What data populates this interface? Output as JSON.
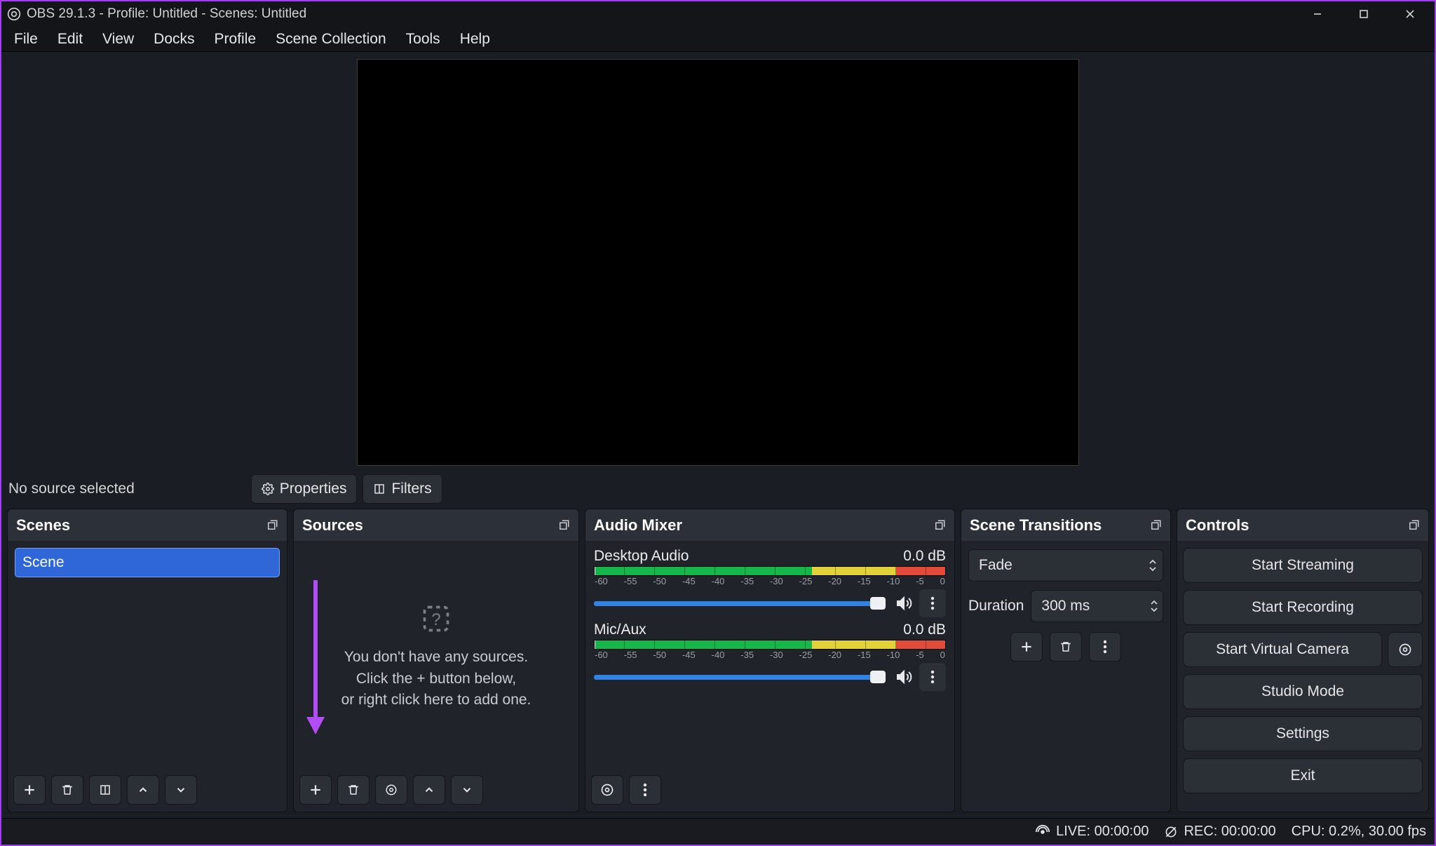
{
  "titlebar": {
    "title": "OBS 29.1.3 - Profile: Untitled - Scenes: Untitled"
  },
  "menu": [
    "File",
    "Edit",
    "View",
    "Docks",
    "Profile",
    "Scene Collection",
    "Tools",
    "Help"
  ],
  "under_preview": {
    "no_source": "No source selected",
    "properties": "Properties",
    "filters": "Filters"
  },
  "dock_titles": {
    "scenes": "Scenes",
    "sources": "Sources",
    "mixer": "Audio Mixer",
    "trans": "Scene Transitions",
    "controls": "Controls"
  },
  "scenes": {
    "items": [
      "Scene"
    ]
  },
  "sources_empty": {
    "line1": "You don't have any sources.",
    "line2": "Click the + button below,",
    "line3": "or right click here to add one."
  },
  "mixer": {
    "channels": [
      {
        "name": "Desktop Audio",
        "level": "0.0 dB"
      },
      {
        "name": "Mic/Aux",
        "level": "0.0 dB"
      }
    ],
    "scale": [
      "-60",
      "-55",
      "-50",
      "-45",
      "-40",
      "-35",
      "-30",
      "-25",
      "-20",
      "-15",
      "-10",
      "-5",
      "0"
    ]
  },
  "transitions": {
    "selected": "Fade",
    "duration_label": "Duration",
    "duration_value": "300 ms"
  },
  "controls": [
    "Start Streaming",
    "Start Recording",
    "Start Virtual Camera",
    "Studio Mode",
    "Settings",
    "Exit"
  ],
  "status": {
    "live": "LIVE: 00:00:00",
    "rec": "REC: 00:00:00",
    "cpu": "CPU: 0.2%, 30.00 fps"
  }
}
